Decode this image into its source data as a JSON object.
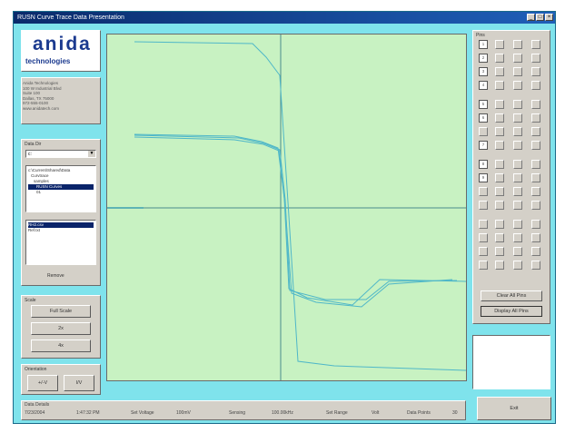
{
  "window": {
    "title": "RUSN Curve Trace Data Presentation"
  },
  "logo": {
    "name": "anida",
    "subtitle": "technologies"
  },
  "address": {
    "lines": [
      "Anida Technologies",
      "100 W Industrial Blvd",
      "Suite 100",
      "Dallas, TX 75000",
      "972-555-0100",
      "www.anidatech.com"
    ]
  },
  "data_dir": {
    "label": "Data Dir",
    "drive": "c:",
    "tree": [
      "c:\\Current\\Shared\\Data",
      "Curvtrace",
      "samples",
      "RUSN Curves",
      "01"
    ],
    "files": [
      "RH2.csv",
      "Ref.txt"
    ],
    "remove_label": "Remove"
  },
  "scale": {
    "label": "Scale",
    "full": "Full Scale",
    "b1": "2x",
    "b2": "4x"
  },
  "orientation": {
    "label": "Orientation",
    "a": "+/-V",
    "b": "I/V"
  },
  "pins": {
    "label": "Pins",
    "groups": [
      {
        "col1": [
          "1",
          "2",
          "3",
          "4"
        ]
      },
      {
        "col1": [
          "5",
          "6",
          "",
          "7"
        ]
      },
      {
        "col1": [
          "8",
          "9",
          "",
          ""
        ]
      },
      {
        "col1": [
          "",
          "",
          "",
          ""
        ]
      }
    ],
    "clear": "Clear All Pins",
    "display": "Display All Pins"
  },
  "status": {
    "label": "Data Details",
    "date": "7/23/2004",
    "time": "1:47:32 PM",
    "setv_label": "Set Voltage",
    "setv": "100mV",
    "sens_label": "Sensing",
    "sens": "100.00kHz",
    "range_label": "Set Range",
    "range": "Volt",
    "pts_label": "Data Points",
    "pts": "30"
  },
  "exit_label": "Exit",
  "colors": {
    "bg": "#7fe3ec",
    "plot": "#c8f2c2",
    "trace": "#4fb7c8"
  }
}
